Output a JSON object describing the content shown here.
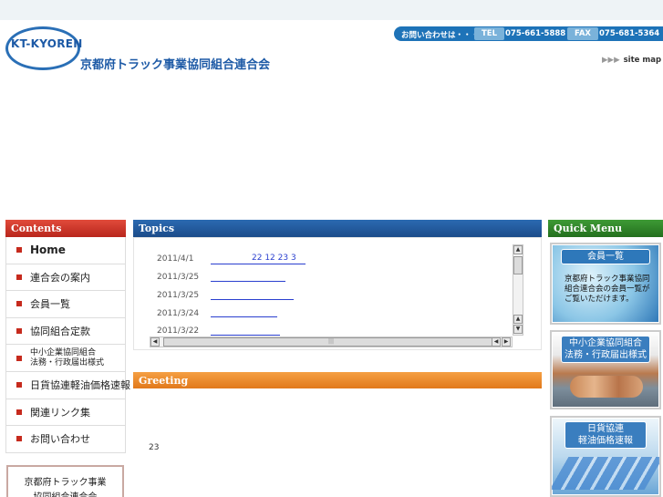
{
  "header": {
    "logo_text": "KT-KYOREN",
    "org_name": "京都府トラック事業協同組合連合会",
    "contact_label": "お問い合わせは・・・",
    "tel_label": "TEL",
    "tel": "075-661-5888",
    "fax_label": "FAX",
    "fax": "075-681-5364",
    "sitemap_arrows": "▶▶▶",
    "sitemap": "site map"
  },
  "sidebar": {
    "title": "Contents",
    "items": [
      {
        "label": "Home"
      },
      {
        "label": "連合会の案内"
      },
      {
        "label": "会員一覧"
      },
      {
        "label": "協同組合定款"
      },
      {
        "label": "中小企業協同組合\n法務・行政届出様式"
      },
      {
        "label": "日貨協連軽油価格速報"
      },
      {
        "label": "関連リンク集"
      },
      {
        "label": "お問い合わせ"
      }
    ],
    "banner": "京都府トラック事業\n協同組合連合会"
  },
  "topics": {
    "title": "Topics",
    "rows": [
      {
        "date": "2011/4/1",
        "link": "22 12   23 3"
      },
      {
        "date": "2011/3/25",
        "link": ""
      },
      {
        "date": "2011/3/25",
        "link": ""
      },
      {
        "date": "2011/3/24",
        "link": ""
      },
      {
        "date": "2011/3/22",
        "link": ""
      }
    ],
    "scroll_up": "▲",
    "scroll_down": "▼",
    "scroll_left": "◀",
    "scroll_right": "▶",
    "grip": "|||"
  },
  "greeting": {
    "title": "Greeting",
    "text": "23"
  },
  "quick_menu": {
    "title": "Quick Menu",
    "cards": [
      {
        "title": "会員一覧",
        "text": "京都府トラック事業協同組合連合会の会員一覧がご覧いただけます。"
      },
      {
        "title": "中小企業協同組合\n法務・行政届出様式",
        "text": ""
      },
      {
        "title": "日貨協連\n軽油価格速報",
        "text": ""
      }
    ]
  },
  "colors": {
    "brand_blue": "#1d5aa6",
    "contents_red": "#c62a1d",
    "topics_blue": "#2b6ab1",
    "quick_green": "#3e9a35",
    "greeting_orange": "#f5a043"
  }
}
